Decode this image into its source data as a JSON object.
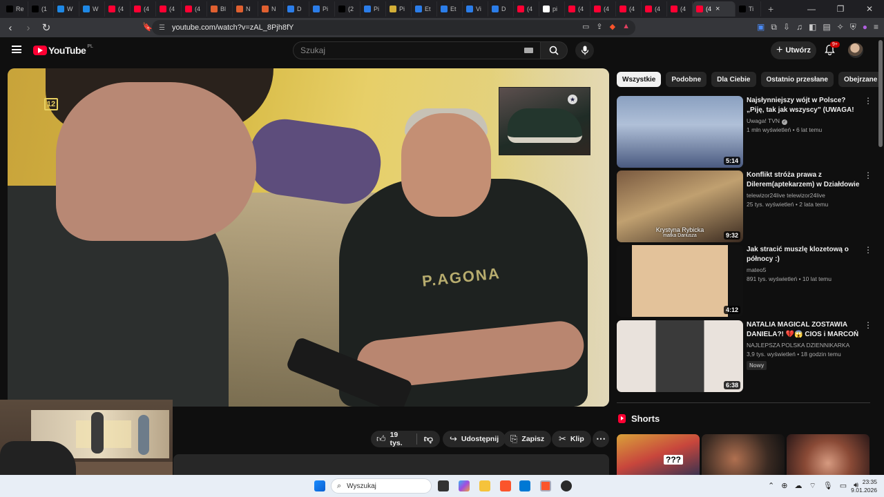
{
  "browser": {
    "tabs": [
      {
        "label": "Re",
        "icon": "tiktok-icon",
        "color": "#000000"
      },
      {
        "label": "(1",
        "icon": "tiktok-icon",
        "color": "#000000"
      },
      {
        "label": "W",
        "icon": "web-icon",
        "color": "#1e88e5"
      },
      {
        "label": "W",
        "icon": "web-icon",
        "color": "#1e88e5"
      },
      {
        "label": "(4",
        "icon": "youtube-icon",
        "color": "#ff0033"
      },
      {
        "label": "(4",
        "icon": "youtube-icon",
        "color": "#ff0033"
      },
      {
        "label": "(4",
        "icon": "youtube-icon",
        "color": "#ff0033"
      },
      {
        "label": "(4",
        "icon": "youtube-icon",
        "color": "#ff0033"
      },
      {
        "label": "Bl",
        "icon": "site-icon",
        "color": "#e06030"
      },
      {
        "label": "N",
        "icon": "site-icon",
        "color": "#e06030"
      },
      {
        "label": "N",
        "icon": "site-icon",
        "color": "#e06030"
      },
      {
        "label": "D",
        "icon": "docs-icon",
        "color": "#2b7de9"
      },
      {
        "label": "Pi",
        "icon": "docs-icon",
        "color": "#2b7de9"
      },
      {
        "label": "(2",
        "icon": "x-icon",
        "color": "#000000"
      },
      {
        "label": "Pi",
        "icon": "docs-icon",
        "color": "#2b7de9"
      },
      {
        "label": "Pi",
        "icon": "flag-icon",
        "color": "#d4af37"
      },
      {
        "label": "Et",
        "icon": "docs-icon",
        "color": "#2b7de9"
      },
      {
        "label": "Et",
        "icon": "docs-icon",
        "color": "#2b7de9"
      },
      {
        "label": "Vi",
        "icon": "docs-icon",
        "color": "#2b7de9"
      },
      {
        "label": "D",
        "icon": "docs-icon",
        "color": "#2b7de9"
      },
      {
        "label": "(4",
        "icon": "youtube-icon",
        "color": "#ff0033"
      },
      {
        "label": "pi",
        "icon": "google-icon",
        "color": "#ffffff"
      },
      {
        "label": "(4",
        "icon": "youtube-icon",
        "color": "#ff0033"
      },
      {
        "label": "(4",
        "icon": "youtube-icon",
        "color": "#ff0033"
      },
      {
        "label": "(4",
        "icon": "youtube-icon",
        "color": "#ff0033"
      },
      {
        "label": "(4",
        "icon": "youtube-icon",
        "color": "#ff0033"
      },
      {
        "label": "(4",
        "icon": "youtube-icon",
        "color": "#ff0033"
      }
    ],
    "active_tab": {
      "label": "(4",
      "close": "×"
    },
    "last_tab": {
      "label": "Ti",
      "icon": "tiktok-icon"
    },
    "new_tab": "+",
    "url": "youtube.com/watch?v=zAL_8Pjh8fY"
  },
  "youtube": {
    "logo_text": "YouTube",
    "country": "PL",
    "search_placeholder": "Szukaj",
    "create_label": "Utwórz",
    "notif_count": "9+"
  },
  "video": {
    "channel_logo": "12",
    "shirt_text": "P.AGONA"
  },
  "actions": {
    "likes": "19 tys.",
    "share": "Udostępnij",
    "save": "Zapisz",
    "clip": "Klip",
    "more": "⋯"
  },
  "chips": [
    "Wszystkie",
    "Podobne",
    "Dla Ciebie",
    "Ostatnio przesłane",
    "Obejrzane"
  ],
  "related": [
    {
      "title": "Najsłynniejszy wójt w Polsce? „Piję, tak jak wszyscy” (UWAGA! TVN)",
      "channel": "Uwaga! TVN",
      "verified": true,
      "meta": "1 mln wyświetleń • 6 lat temu",
      "duration": "5:14",
      "badge": ""
    },
    {
      "title": "Konflikt stróża prawa z Dilerem(aptekarzem) w Działdowie - ...",
      "channel": "telewizor24live telewizor24live",
      "verified": false,
      "meta": "25 tys. wyświetleń • 2 lata temu",
      "duration": "9:32",
      "badge": "",
      "caption1": "Krystyna Rybicka",
      "caption2": "matka Dariusza"
    },
    {
      "title": "Jak stracić muszlę klozetową o północy :)",
      "channel": "mateo5",
      "verified": false,
      "meta": "891 tys. wyświetleń • 10 lat temu",
      "duration": "4:12",
      "badge": ""
    },
    {
      "title": "NATALIA MAGICAL ZOSTAWIA DANIELA?! 💔😱 CIOS i MARCOŃ ...",
      "channel": "NAJLEPSZA POLSKA DZIENNIKARKA",
      "verified": false,
      "meta": "3,9 tys. wyświetleń • 18 godzin temu",
      "duration": "6:38",
      "badge": "Nowy"
    }
  ],
  "shorts": {
    "title": "Shorts",
    "first_caption": "???"
  },
  "taskbar": {
    "search": "Wyszukaj",
    "time": "23:35",
    "date": "9.01.2026"
  }
}
